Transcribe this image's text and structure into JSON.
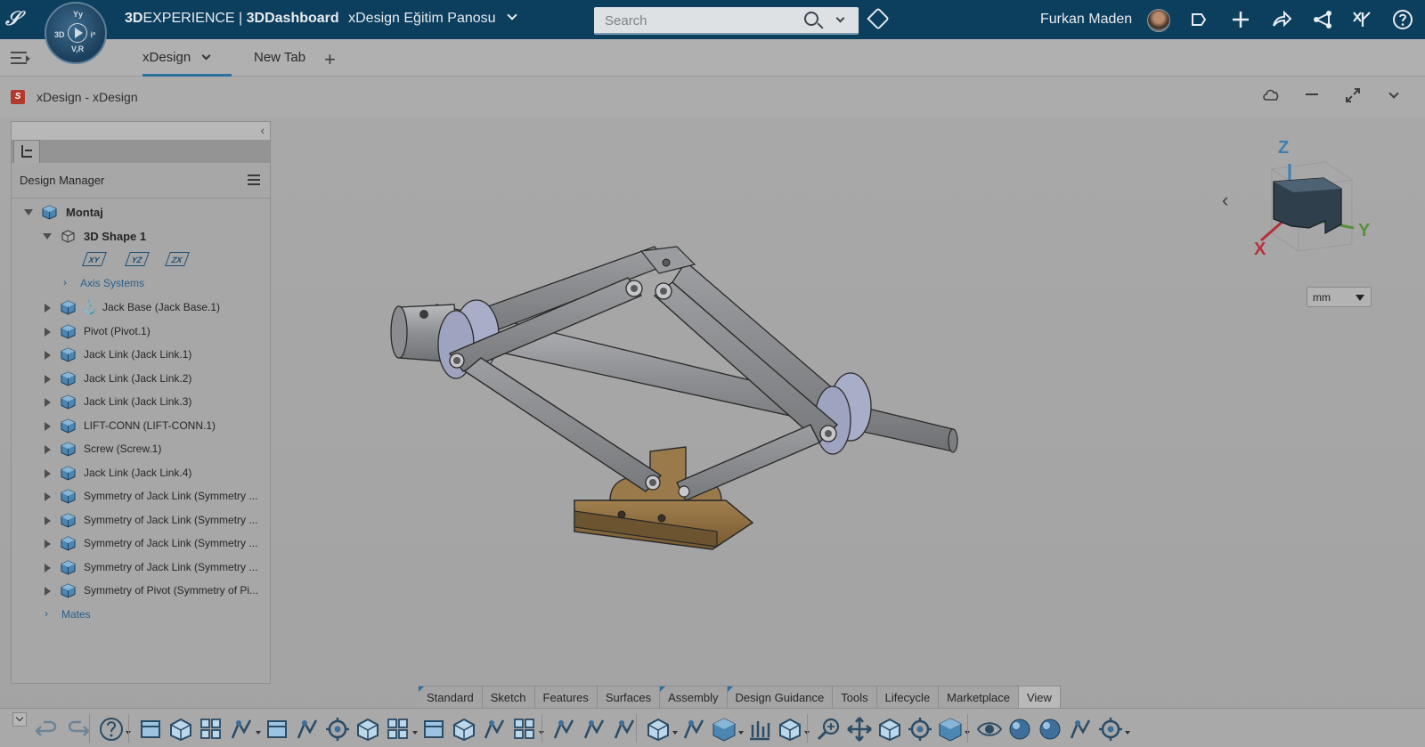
{
  "topbar": {
    "brand_3d": "3D",
    "brand_experience": "EXPERIENCE",
    "brand_sep": " | ",
    "brand_dashboard": "3DDashboard",
    "app_name": "xDesign Eğitim Panosu",
    "search_placeholder": "Search",
    "user_name": "Furkan Maden",
    "compass": {
      "n": "Yy",
      "w": "3D",
      "e": "i³",
      "s": "V,R"
    },
    "icons": [
      "tag-icon",
      "feed-icon",
      "add-icon",
      "share-icon",
      "network-icon",
      "apps-icon",
      "help-icon"
    ]
  },
  "tabs": [
    {
      "label": "xDesign",
      "active": true
    },
    {
      "label": "New Tab",
      "active": false
    }
  ],
  "widget": {
    "title": "xDesign - xDesign",
    "icons": [
      "cloud-icon",
      "minimize-icon",
      "maximize-icon",
      "chevron-down-icon"
    ]
  },
  "tree": {
    "panel_title": "Design Manager",
    "root": "Montaj",
    "shape": "3D Shape 1",
    "planes": [
      "XY",
      "YZ",
      "ZX"
    ],
    "axis_systems": "Axis Systems",
    "items": [
      "Jack Base (Jack Base.1)",
      "Pivot (Pivot.1)",
      "Jack Link (Jack Link.1)",
      "Jack Link (Jack Link.2)",
      "Jack Link (Jack Link.3)",
      "LIFT-CONN (LIFT-CONN.1)",
      "Screw (Screw.1)",
      "Jack Link (Jack Link.4)",
      "Symmetry of Jack Link (Symmetry ...",
      "Symmetry of Jack Link (Symmetry ...",
      "Symmetry of Jack Link (Symmetry ...",
      "Symmetry of Jack Link (Symmetry ...",
      "Symmetry of Pivot (Symmetry of Pi..."
    ],
    "mates": "Mates"
  },
  "viewport": {
    "triad": {
      "x": "X",
      "y": "Y",
      "z": "Z"
    },
    "unit": "mm",
    "colors": {
      "link": "#8d8f92",
      "base": "#8a6e43",
      "axis_x": "#b6303a",
      "axis_y": "#5a8f3a",
      "axis_z": "#3e7fb3"
    }
  },
  "command_tabs": [
    "Standard",
    "Sketch",
    "Features",
    "Surfaces",
    "Assembly",
    "Design Guidance",
    "Tools",
    "Lifecycle",
    "Marketplace",
    "View"
  ],
  "active_command_tab": "View",
  "toolbar_icons": [
    "undo-icon",
    "redo-icon",
    "help-icon",
    "smart-mate-icon",
    "insert-component-icon",
    "new-component-icon",
    "pattern-icon",
    "align-icon",
    "explode-icon",
    "mate-icon",
    "attach-icon",
    "settings-icon",
    "fixed-icon",
    "mirror-icon",
    "replace-icon",
    "instance-icon",
    "sketch-plane-icon",
    "measure-icon",
    "comment-icon",
    "rotate-icon",
    "section-icon",
    "view-cube-icon",
    "chart-icon",
    "layers-icon",
    "zoom-icon",
    "pan-icon",
    "rotate-view-icon",
    "zoom-area-icon",
    "standard-views-icon",
    "hide-show-icon",
    "appearance-icon",
    "render-icon",
    "section-view-icon",
    "more-icon"
  ]
}
